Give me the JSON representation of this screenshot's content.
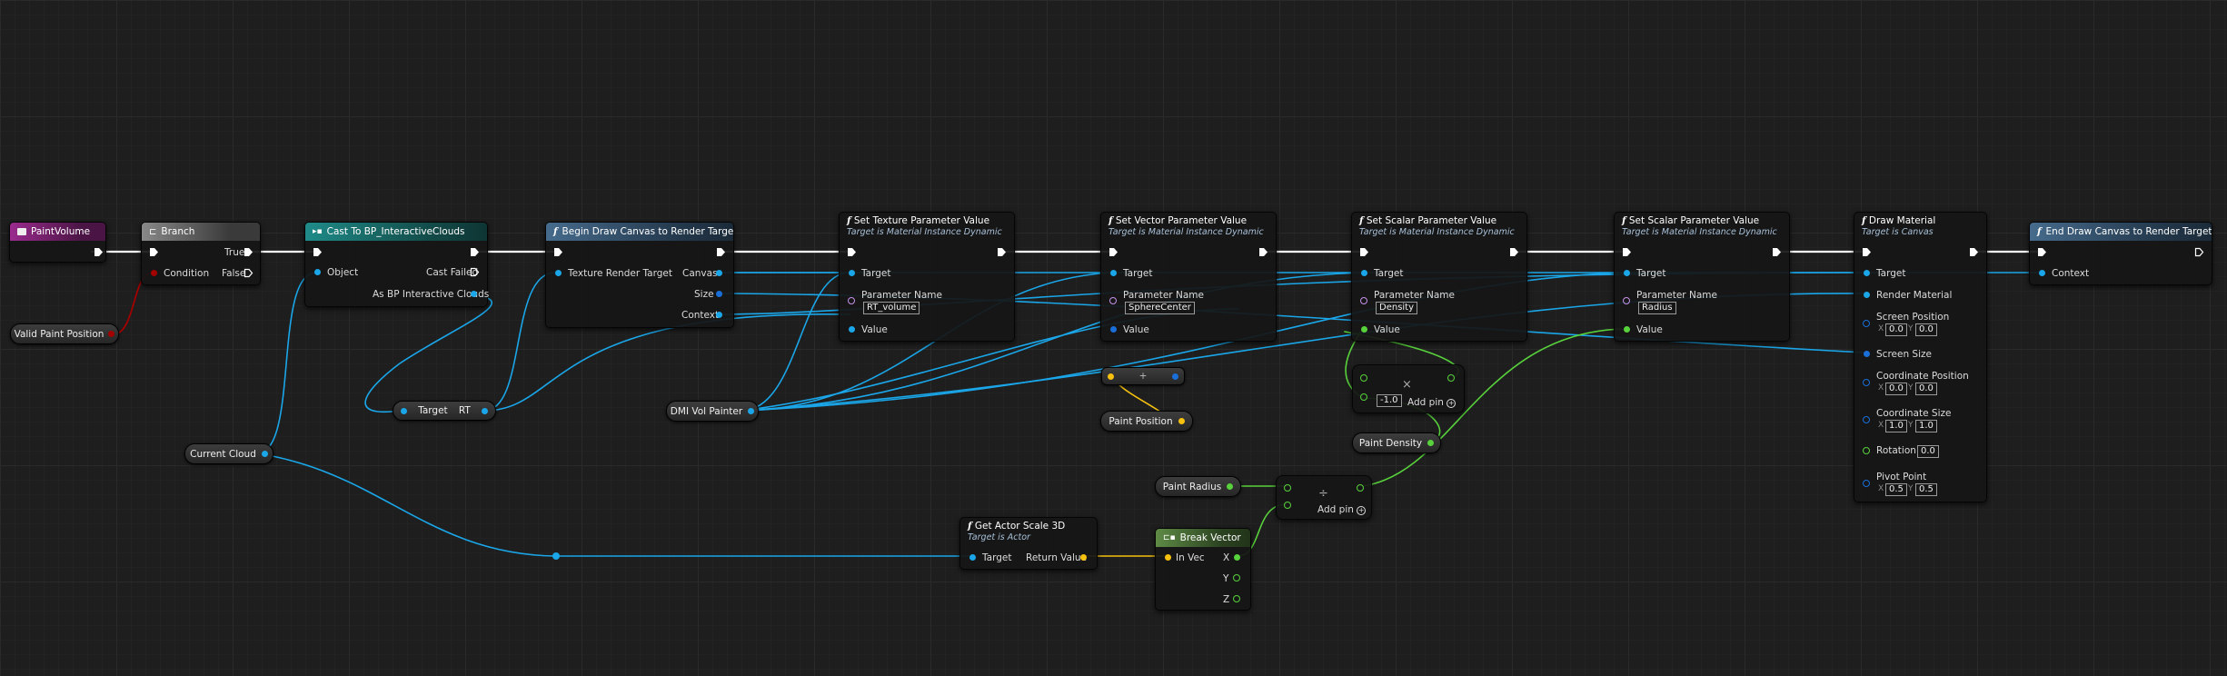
{
  "colors": {
    "exec": "#ffffff",
    "object": "#1aa6e8",
    "float": "#58d23c",
    "vector": "#f6c10f",
    "bool": "#a30000",
    "name": "#c792ea",
    "function_header": "#466b8c",
    "cast_header": "#1f8b88",
    "event_header": "#9b2b8e",
    "pure_header": "#5e8a45"
  },
  "nodes": {
    "paint_volume": {
      "title": "PaintVolume",
      "icon": "event-icon"
    },
    "branch": {
      "title": "Branch",
      "pins": {
        "condition": "Condition",
        "true": "True",
        "false": "False"
      }
    },
    "cast": {
      "title": "Cast To BP_InteractiveClouds",
      "pins": {
        "object": "Object",
        "cast_failed": "Cast Failed",
        "as_bp": "As BP Interactive Clouds"
      }
    },
    "begin_draw": {
      "title": "Begin Draw Canvas to Render Target",
      "pins": {
        "texture_rt": "Texture Render Target",
        "canvas": "Canvas",
        "size": "Size",
        "context": "Context"
      }
    },
    "set_texture": {
      "title": "Set Texture Parameter Value",
      "subtitle": "Target is Material Instance Dynamic",
      "pins": {
        "target": "Target",
        "param_name": "Parameter Name",
        "param_value": "RT_volume",
        "value": "Value"
      }
    },
    "set_vector": {
      "title": "Set Vector Parameter Value",
      "subtitle": "Target is Material Instance Dynamic",
      "pins": {
        "target": "Target",
        "param_name": "Parameter Name",
        "param_value": "SphereCenter",
        "value": "Value"
      }
    },
    "set_scalar_density": {
      "title": "Set Scalar Parameter Value",
      "subtitle": "Target is Material Instance Dynamic",
      "pins": {
        "target": "Target",
        "param_name": "Parameter Name",
        "param_value": "Density",
        "value": "Value"
      }
    },
    "set_scalar_radius": {
      "title": "Set Scalar Parameter Value",
      "subtitle": "Target is Material Instance Dynamic",
      "pins": {
        "target": "Target",
        "param_name": "Parameter Name",
        "param_value": "Radius",
        "value": "Value"
      }
    },
    "draw_material": {
      "title": "Draw Material",
      "subtitle": "Target is Canvas",
      "pins": {
        "target": "Target",
        "render_material": "Render Material",
        "screen_position": "Screen Position",
        "sp_x": "0.0",
        "sp_y": "0.0",
        "screen_size": "Screen Size",
        "coordinate_position": "Coordinate Position",
        "cp_x": "0.0",
        "cp_y": "0.0",
        "coordinate_size": "Coordinate Size",
        "cs_x": "1.0",
        "cs_y": "1.0",
        "rotation": "Rotation",
        "rot": "0.0",
        "pivot_point": "Pivot Point",
        "pp_x": "0.5",
        "pp_y": "0.5",
        "x": "X",
        "y": "Y"
      }
    },
    "end_draw": {
      "title": "End Draw Canvas to Render Target",
      "pins": {
        "context": "Context"
      }
    },
    "get_actor_scale": {
      "title": "Get Actor Scale 3D",
      "subtitle": "Target is Actor",
      "pins": {
        "target": "Target",
        "return_value": "Return Value"
      }
    },
    "break_vector": {
      "title": "Break Vector",
      "pins": {
        "in_vec": "In Vec",
        "x": "X",
        "y": "Y",
        "z": "Z"
      }
    },
    "multiply": {
      "symbol": "×",
      "const": "-1.0",
      "add_pin": "Add pin"
    },
    "divide": {
      "symbol": "÷",
      "add_pin": "Add pin"
    },
    "vector_add": {
      "symbol": "+"
    }
  },
  "variables": {
    "valid_paint_position": "Valid Paint Position",
    "current_cloud": "Current Cloud",
    "target_rt": {
      "left": "Target",
      "right": "RT"
    },
    "dmi_vol_painter": "DMI Vol Painter",
    "paint_position": "Paint Position",
    "paint_density": "Paint Density",
    "paint_radius": "Paint Radius"
  }
}
